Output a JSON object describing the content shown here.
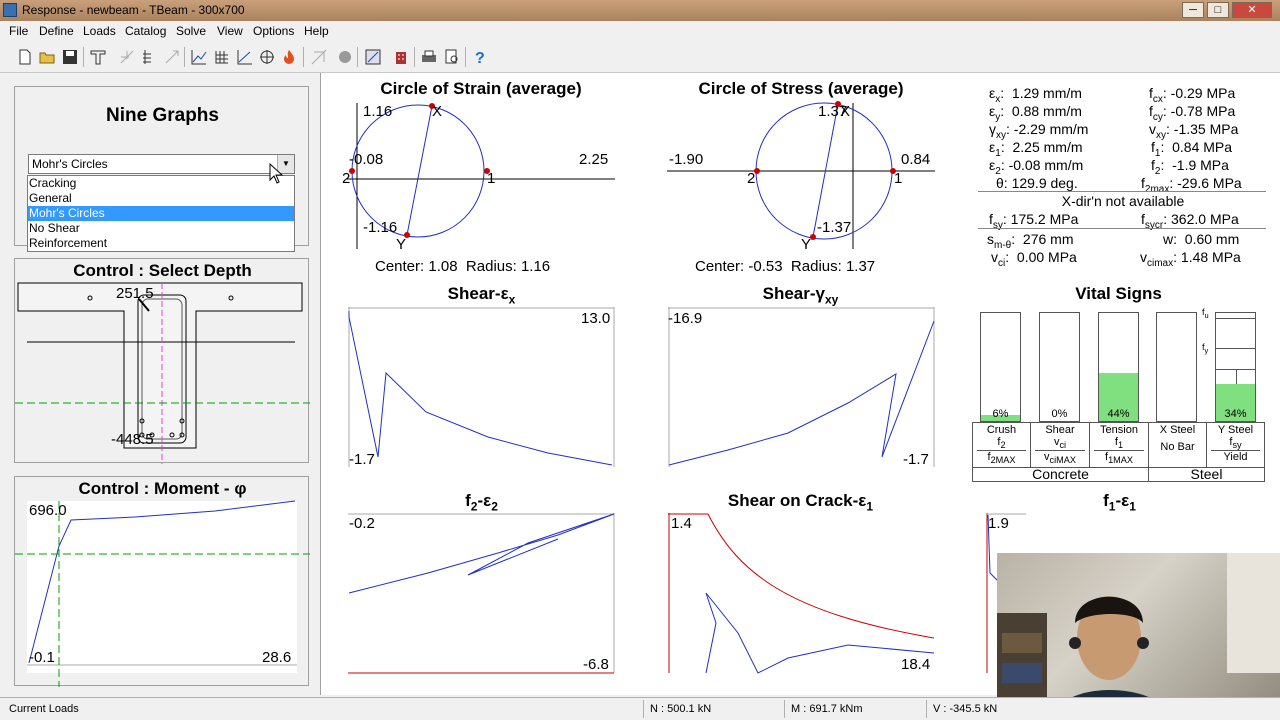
{
  "window": {
    "title": "Response  -  newbeam  -  TBeam - 300x700",
    "minimize": "─",
    "maximize": "□",
    "close": "✕"
  },
  "menu": [
    "File",
    "Define",
    "Loads",
    "Catalog",
    "Solve",
    "View",
    "Options",
    "Help"
  ],
  "left": {
    "heading": "Nine Graphs",
    "combo_value": "Mohr's Circles",
    "options": [
      "Cracking",
      "General",
      "Mohr's Circles",
      "No Shear",
      "Reinforcement"
    ],
    "selected_option": "Mohr's Circles",
    "depth_title": "Control : Select Depth",
    "depth_top": "251.5",
    "depth_bottom": "-448.5",
    "moment_title": "Control : Moment - φ",
    "moment_y_top": "696.0",
    "moment_y_bottom": "-0.1",
    "moment_x_right": "28.6"
  },
  "graphs": {
    "strain_circle": {
      "title": "Circle of Strain (average)",
      "top": "1.16",
      "bottom": "-1.16",
      "left": "-0.08",
      "right": "2.25",
      "pt_left": "2",
      "pt_right": "1",
      "pt_x": "X",
      "pt_y": "Y",
      "center_label": "Center:",
      "center": "1.08",
      "radius_label": "Radius:",
      "radius": "1.16"
    },
    "stress_circle": {
      "title": "Circle of Stress (average)",
      "top": "1.37",
      "bottom": "-1.37",
      "left": "-1.90",
      "right": "0.84",
      "pt_left": "2",
      "pt_right": "1",
      "pt_x": "X",
      "pt_y": "Y",
      "center_label": "Center:",
      "center": "-0.53",
      "radius_label": "Radius:",
      "radius": "1.37"
    },
    "shear_ex": {
      "title_main": "Shear-ε",
      "title_sub": "x",
      "top_right": "13.0",
      "bottom_left": "-1.7"
    },
    "shear_gxy": {
      "title_main": "Shear-γ",
      "title_sub": "xy",
      "top_left": "-16.9",
      "bottom_right": "-1.7"
    },
    "f2_e2": {
      "title_a": "f",
      "title_a_sub": "2",
      "title_b": "-ε",
      "title_b_sub": "2",
      "top_left": "-0.2",
      "bottom_right": "-6.8"
    },
    "shear_crack": {
      "title_main": "Shear on Crack-ε",
      "title_sub": "1",
      "top_left": "1.4",
      "bottom_right": "18.4"
    },
    "f1_e1": {
      "title_a": "f",
      "title_a_sub": "1",
      "title_b": "-ε",
      "title_b_sub": "1",
      "top_left": "1.9"
    }
  },
  "results": {
    "ex": {
      "sym": "ε",
      "sub": "x",
      "val": "1.29 mm/m"
    },
    "ey": {
      "sym": "ε",
      "sub": "y",
      "val": "0.88 mm/m"
    },
    "gxy": {
      "sym": "γ",
      "sub": "xy",
      "val": "-2.29 mm/m"
    },
    "e1": {
      "sym": "ε",
      "sub": "1",
      "val": "2.25 mm/m"
    },
    "e2": {
      "sym": "ε",
      "sub": "2",
      "val": "-0.08 mm/m"
    },
    "theta": "θ: 129.9 deg.",
    "fcx": {
      "sym": "f",
      "sub": "cx",
      "val": "-0.29 MPa"
    },
    "fcy": {
      "sym": "f",
      "sub": "cy",
      "val": "-0.78 MPa"
    },
    "vxy": {
      "sym": "v",
      "sub": "xy",
      "val": "-1.35 MPa"
    },
    "f1": {
      "sym": "f",
      "sub": "1",
      "val": "0.84 MPa"
    },
    "f2": {
      "sym": "f",
      "sub": "2",
      "val": "-1.9 MPa"
    },
    "f2max": {
      "sym": "f",
      "sub": "2max",
      "val": "-29.6 MPa"
    },
    "xdir": "X-dir'n not available",
    "fsy": {
      "sym": "f",
      "sub": "sy",
      "val": "175.2 MPa"
    },
    "fsycr": {
      "sym": "f",
      "sub": "sycr",
      "val": "362.0 MPa"
    },
    "sm": {
      "sym": "s",
      "sub": "m-θ",
      "val": "276 mm"
    },
    "w": {
      "sym": "w",
      "sub": "",
      "val": "0.60 mm"
    },
    "vci": {
      "sym": "v",
      "sub": "ci",
      "val": "0.00 MPa"
    },
    "vcimax": {
      "sym": "v",
      "sub": "cimax",
      "val": "1.48 MPa"
    }
  },
  "vital": {
    "title": "Vital Signs",
    "bars": [
      {
        "pct": "6%",
        "fill": 0.06,
        "name": "Crush",
        "sym": "f",
        "sub": "2",
        "den": "f",
        "den_sub": "2MAX"
      },
      {
        "pct": "0%",
        "fill": 0.0,
        "name": "Shear",
        "sym": "v",
        "sub": "ci",
        "den": "v",
        "den_sub": "ciMAX"
      },
      {
        "pct": "44%",
        "fill": 0.44,
        "name": "Tension",
        "sym": "f",
        "sub": "1",
        "den": "f",
        "den_sub": "1MAX"
      },
      {
        "pct": "",
        "fill": 0.0,
        "name": "X Steel",
        "sym": "No Bar",
        "sub": "",
        "den": "",
        "den_sub": ""
      },
      {
        "pct": "34%",
        "fill": 0.34,
        "name": "Y Steel",
        "sym": "f",
        "sub": "sy",
        "den": "Yield",
        "den_sub": ""
      }
    ],
    "fu": "f",
    "fu_sub": "u",
    "fy": "f",
    "fy_sub": "y",
    "concrete": "Concrete",
    "steel": "Steel"
  },
  "status": {
    "left": "Current Loads",
    "n": "N : 500.1 kN",
    "m": "M : 691.7 kNm",
    "v": "V : -345.5 kN"
  }
}
